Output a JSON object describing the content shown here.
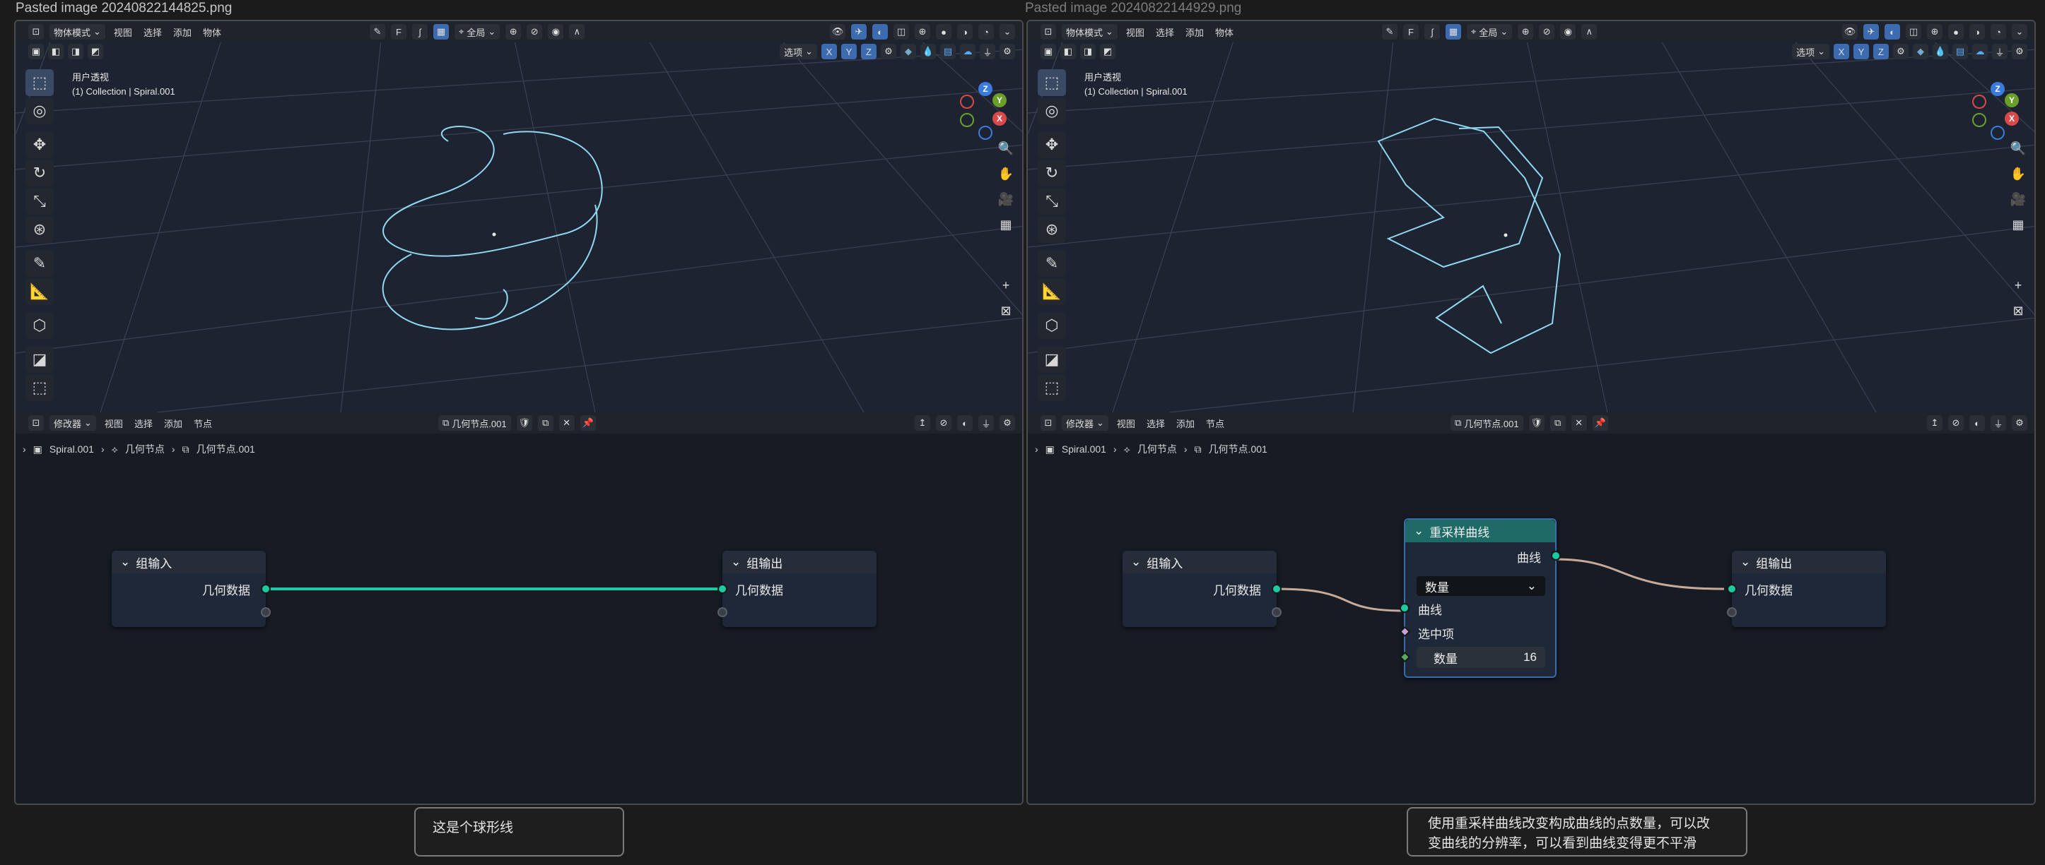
{
  "captions": {
    "left": "Pasted image 20240822144825.png",
    "right": "Pasted image 20240822144929.png"
  },
  "viewport": {
    "mode": "物体模式",
    "menus": [
      "视图",
      "选择",
      "添加",
      "物体"
    ],
    "transform_orientation": "全局",
    "options_label": "选项",
    "axes": [
      "X",
      "Y",
      "Z"
    ],
    "view_name": "用户透视",
    "collection_line": "(1) Collection | Spiral.001",
    "gizmo_axes": {
      "x": "X",
      "y": "Y",
      "z": "Z"
    }
  },
  "node_editor": {
    "editor_type": "修改器",
    "menus": [
      "视图",
      "选择",
      "添加",
      "节点"
    ],
    "tree_name": "几何节点.001",
    "breadcrumb": [
      "Spiral.001",
      "几何节点",
      "几何节点.001"
    ]
  },
  "left_nodes": {
    "group_input": {
      "title": "组输入",
      "output": "几何数据"
    },
    "group_output": {
      "title": "组输出",
      "input": "几何数据"
    }
  },
  "right_nodes": {
    "group_input": {
      "title": "组输入",
      "output": "几何数据"
    },
    "resample": {
      "title": "重采样曲线",
      "output": "曲线",
      "mode": "数量",
      "input_curve": "曲线",
      "input_selection": "选中项",
      "count_label": "数量",
      "count_value": "16"
    },
    "group_output": {
      "title": "组输出",
      "input": "几何数据"
    }
  },
  "notes": {
    "left": "这是个球形线",
    "right_line1": "使用重采样曲线改变构成曲线的点数量，可以改",
    "right_line2": "变曲线的分辨率，可以看到曲线变得更不平滑"
  },
  "colors": {
    "accent": "#3d6bb0",
    "socket_geometry": "#1ec8a0",
    "curve_wire": "#8fd8f0",
    "node_header_resample": "#1d6a66"
  }
}
